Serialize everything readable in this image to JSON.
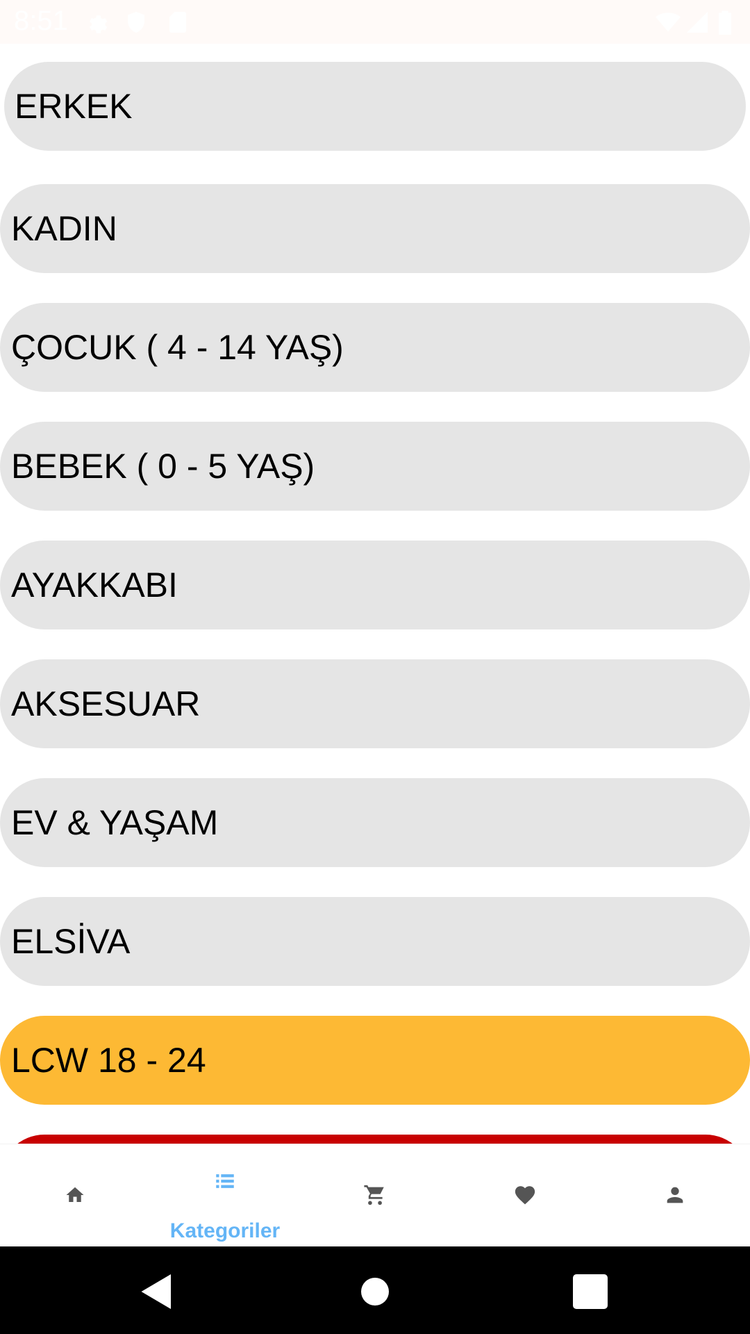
{
  "status_bar": {
    "time": "8:51",
    "icons": [
      "gear-icon",
      "shield-icon",
      "sd-card-icon",
      "wifi-icon",
      "signal-icon",
      "battery-icon"
    ]
  },
  "categories": [
    {
      "label": "ERKEK",
      "color": "#e5e5e5"
    },
    {
      "label": "KADIN",
      "color": "#e5e5e5"
    },
    {
      "label": "ÇOCUK ( 4 - 14 YAŞ)",
      "color": "#e5e5e5"
    },
    {
      "label": "BEBEK ( 0 - 5 YAŞ)",
      "color": "#e5e5e5"
    },
    {
      "label": "AYAKKABI",
      "color": "#e5e5e5"
    },
    {
      "label": "AKSESUAR",
      "color": "#e5e5e5"
    },
    {
      "label": "EV & YAŞAM",
      "color": "#e5e5e5"
    },
    {
      "label": "ELSİVA",
      "color": "#e5e5e5"
    },
    {
      "label": "LCW 18 - 24",
      "color": "#fdb934"
    },
    {
      "label": "",
      "color": "#c80000"
    }
  ],
  "bottom_nav": {
    "items": [
      {
        "icon": "home-icon",
        "label": "",
        "active": false
      },
      {
        "icon": "list-icon",
        "label": "Kategoriler",
        "active": true
      },
      {
        "icon": "cart-icon",
        "label": "",
        "active": false
      },
      {
        "icon": "heart-icon",
        "label": "",
        "active": false
      },
      {
        "icon": "person-icon",
        "label": "",
        "active": false
      }
    ],
    "active_color": "#64b5f6",
    "inactive_color": "#555555"
  },
  "system_nav": {
    "buttons": [
      "back-icon",
      "home-circle-icon",
      "recents-icon"
    ]
  }
}
